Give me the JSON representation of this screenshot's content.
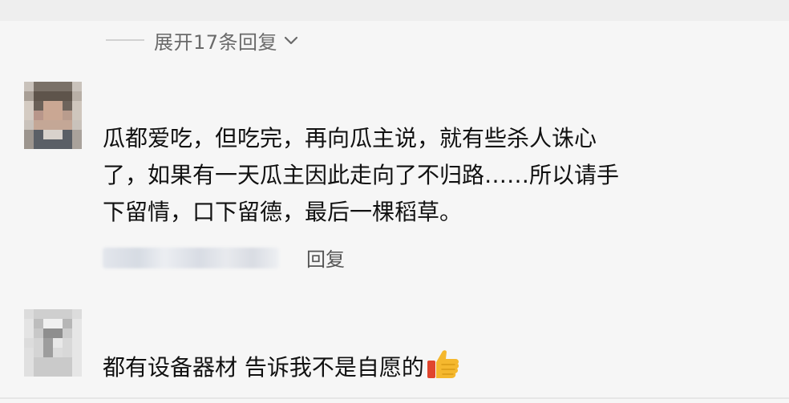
{
  "expand_replies": {
    "label": "展开17条回复",
    "icon": "chevron-down-icon"
  },
  "comments": [
    {
      "avatar_icon": "avatar-pixelated",
      "text": "瓜都爱吃，但吃完，再向瓜主说，就有些杀人诛心\n了，如果有一天瓜主因此走向了不归路……所以请手\n下留情，口下留德，最后一棵稻草。",
      "reply_label": "回复"
    },
    {
      "avatar_icon": "avatar-pixelated",
      "text": "都有设备器材 告诉我不是自愿的",
      "emoji": "thumbs-up-icon"
    }
  ],
  "colors": {
    "background": "#f6f6f6",
    "muted_text": "#6a6a6a",
    "body_text": "#111111",
    "thumb_yellow": "#f5b82e",
    "thumb_red": "#e0452e"
  }
}
